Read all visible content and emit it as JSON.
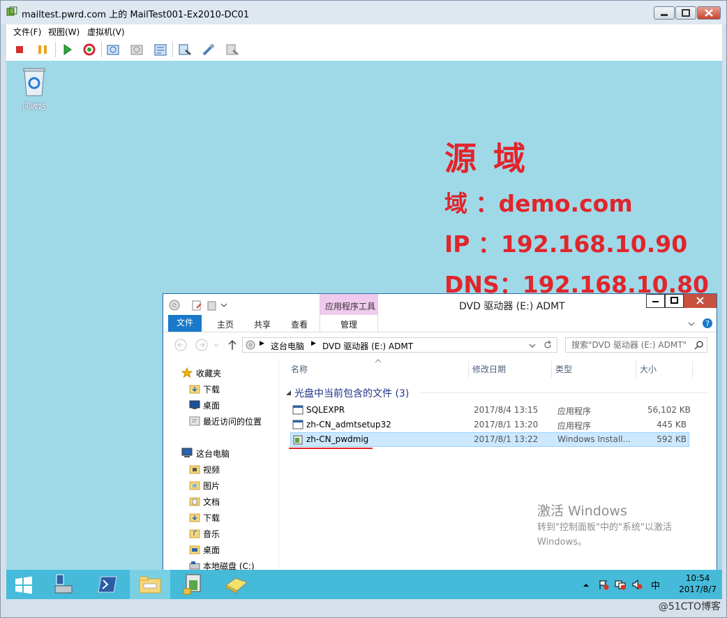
{
  "vm": {
    "title": "mailtest.pwrd.com 上的 MailTest001-Ex2010-DC01",
    "menu": [
      "文件(F)",
      "视图(W)",
      "虚拟机(V)"
    ]
  },
  "desktop": {
    "recycle_label": "回收站",
    "wallpaper_text": {
      "heading": "源 域",
      "domain": "域   ：demo.com",
      "ip": "IP   ：192.168.10.90",
      "dns": "DNS：192.168.10.80"
    }
  },
  "explorer": {
    "title": "DVD 驱动器 (E:) ADMT",
    "context_tab": "应用程序工具",
    "tabs": {
      "file": "文件",
      "home": "主页",
      "share": "共享",
      "view": "查看",
      "manage": "管理"
    },
    "breadcrumb": [
      "这台电脑",
      "DVD 驱动器 (E:) ADMT"
    ],
    "search_placeholder": "搜索\"DVD 驱动器 (E:) ADMT\"",
    "nav": {
      "favorites": "收藏夹",
      "fav_items": [
        "下载",
        "桌面",
        "最近访问的位置"
      ],
      "this_pc": "这台电脑",
      "pc_items": [
        "视频",
        "图片",
        "文档",
        "下载",
        "音乐",
        "桌面",
        "本地磁盘 (C:)"
      ]
    },
    "columns": {
      "name": "名称",
      "modified": "修改日期",
      "type": "类型",
      "size": "大小"
    },
    "group_label": "光盘中当前包含的文件 (3)",
    "files": [
      {
        "name": "SQLEXPR",
        "modified": "2017/8/4 13:15",
        "type": "应用程序",
        "size": "56,102 KB"
      },
      {
        "name": "zh-CN_admtsetup32",
        "modified": "2017/8/1 13:20",
        "type": "应用程序",
        "size": "445 KB"
      },
      {
        "name": "zh-CN_pwdmig",
        "modified": "2017/8/1 13:22",
        "type": "Windows Install...",
        "size": "592 KB"
      }
    ],
    "activation": {
      "title": "激活 Windows",
      "line1": "转到\"控制面板\"中的\"系统\"以激活",
      "line2": "Windows。"
    }
  },
  "taskbar": {
    "time": "10:54",
    "date": "2017/8/7",
    "ime": "中"
  },
  "blog_mark": "@51CTO博客",
  "colors": {
    "accent": "#1979ca",
    "desktop": "#9fd9e8",
    "taskbar": "#45bbd9",
    "wallpaper_text": "#e0252b"
  }
}
